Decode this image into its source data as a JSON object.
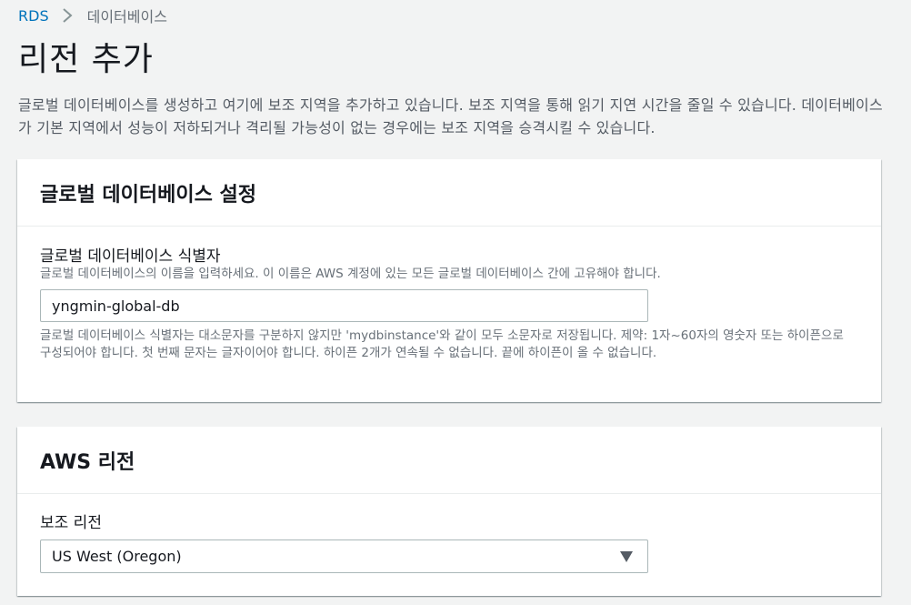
{
  "breadcrumb": {
    "root": "RDS",
    "current": "데이터베이스"
  },
  "page": {
    "title": "리전 추가",
    "intro": "글로벌 데이터베이스를 생성하고 여기에 보조 지역을 추가하고 있습니다. 보조 지역을 통해 읽기 지연 시간을 줄일 수 있습니다. 데이터베이스가 기본 지역에서 성능이 저하되거나 격리될 가능성이 없는 경우에는 보조 지역을 승격시킬 수 있습니다."
  },
  "global_settings": {
    "title": "글로벌 데이터베이스 설정",
    "identifier_label": "글로벌 데이터베이스 식별자",
    "identifier_description": "글로벌 데이터베이스의 이름을 입력하세요. 이 이름은 AWS 계정에 있는 모든 글로벌 데이터베이스 간에 고유해야 합니다.",
    "identifier_value": "yngmin-global-db",
    "identifier_constraint": "글로벌 데이터베이스 식별자는 대소문자를 구분하지 않지만 'mydbinstance'와 같이 모두 소문자로 저장됩니다. 제약: 1자~60자의 영숫자 또는 하이픈으로 구성되어야 합니다. 첫 번째 문자는 글자이어야 합니다. 하이픈 2개가 연속될 수 없습니다. 끝에 하이픈이 올 수 없습니다."
  },
  "aws_region": {
    "title": "AWS 리전",
    "secondary_region_label": "보조 리전",
    "secondary_region_value": "US West (Oregon)"
  },
  "colors": {
    "link": "#0073bb",
    "background": "#f2f3f3",
    "panel": "#ffffff",
    "muted_text": "#687078"
  },
  "icons": {
    "breadcrumb_separator": "chevron-right-icon",
    "select_caret": "caret-down-icon"
  }
}
